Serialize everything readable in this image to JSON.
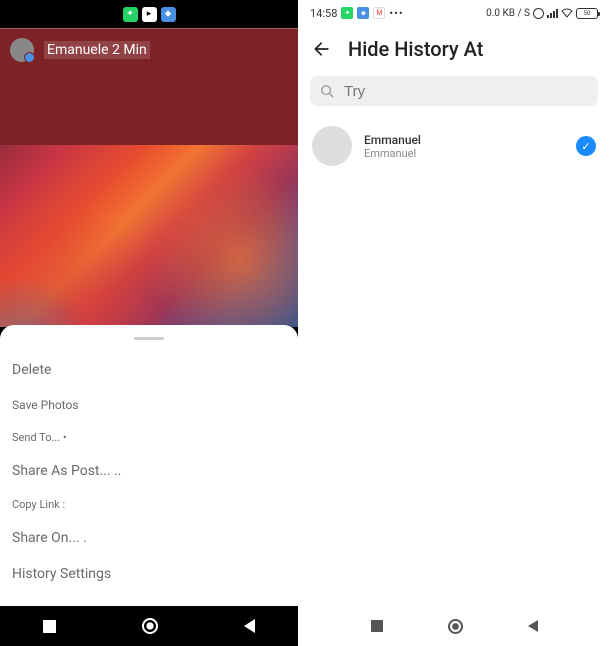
{
  "left": {
    "header": {
      "username": "Emanuele 2 Min"
    },
    "sheet": {
      "items": [
        {
          "label": "Delete",
          "size": "normal"
        },
        {
          "label": "Save Photos",
          "size": "sm"
        },
        {
          "label": "Send To... •",
          "size": "xs"
        },
        {
          "label": "Share As Post... ..",
          "size": "normal"
        },
        {
          "label": "Copy Link :",
          "size": "xs"
        },
        {
          "label": "Share On... .",
          "size": "normal"
        },
        {
          "label": "History Settings",
          "size": "normal"
        }
      ]
    }
  },
  "right": {
    "status": {
      "time": "14:58",
      "data_rate": "0.0 KB / S",
      "battery": "50"
    },
    "header": {
      "title": "Hide History At"
    },
    "search": {
      "placeholder": "Try"
    },
    "list": [
      {
        "name": "Emmanuel",
        "sub": "Emmanuel",
        "checked": true
      }
    ]
  }
}
